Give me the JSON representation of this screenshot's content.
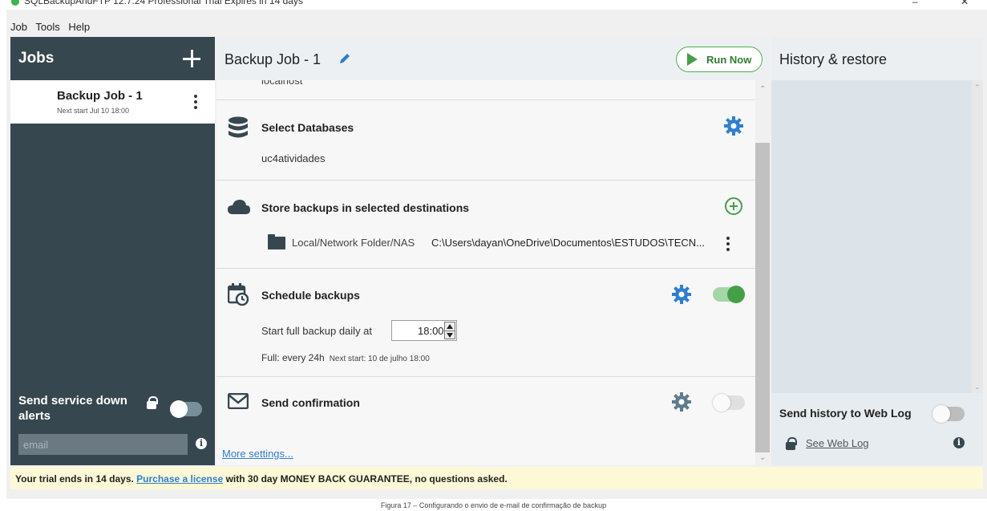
{
  "window": {
    "title": "SQLBackupAndFTP   12.7.24 Professional Trial Expires in 14 days",
    "minimize": "–",
    "close": "✕"
  },
  "menu": {
    "items": [
      "Job",
      "Tools",
      "Help"
    ]
  },
  "sidebar": {
    "title": "Jobs",
    "add_icon": "plus-icon",
    "jobs": [
      {
        "name": "Backup Job - 1",
        "next_start": "Next start Jul 10 18:00"
      }
    ],
    "alerts_label": "Send service down alerts",
    "alerts_enabled": false,
    "email_placeholder": "email",
    "info": "i"
  },
  "main": {
    "title": "Backup Job - 1",
    "run_label": "Run Now",
    "cutoff_text": "localhost",
    "sections": {
      "databases": {
        "title": "Select Databases",
        "value": "uc4atividades",
        "icon": "database-icon"
      },
      "destinations": {
        "title": "Store backups in selected destinations",
        "icon": "cloud-icon",
        "dest_type": "Local/Network Folder/NAS",
        "dest_path": "C:\\Users\\dayan\\OneDrive\\Documentos\\ESTUDOS\\TECN..."
      },
      "schedule": {
        "title": "Schedule backups",
        "icon": "calendar-clock-icon",
        "enabled": true,
        "label": "Start full backup daily at",
        "time": "18:00",
        "freq": "Full:  every 24h",
        "next": "Next start: 10 de julho 18:00"
      },
      "confirmation": {
        "title": "Send confirmation",
        "icon": "envelope-icon",
        "enabled": false
      }
    },
    "more_settings": "More settings..."
  },
  "history": {
    "title": "History & restore",
    "weblog_label": "Send history to Web Log",
    "weblog_enabled": false,
    "see_weblog": "See Web Log",
    "info": "i"
  },
  "trial": {
    "prefix": "Your trial ends in 14 days.",
    "link": "Purchase a license",
    "suffix": "with 30 day MONEY BACK GUARANTEE, no questions asked."
  },
  "caption": "Figura 17 – Configurando o envio de e-mail de confirmação de backup",
  "colors": {
    "sidebar": "#37474f",
    "accent_green": "#43a047",
    "gear_blue": "#2d7fd3",
    "gear_grey": "#607d8b",
    "link": "#2d7fd3"
  }
}
